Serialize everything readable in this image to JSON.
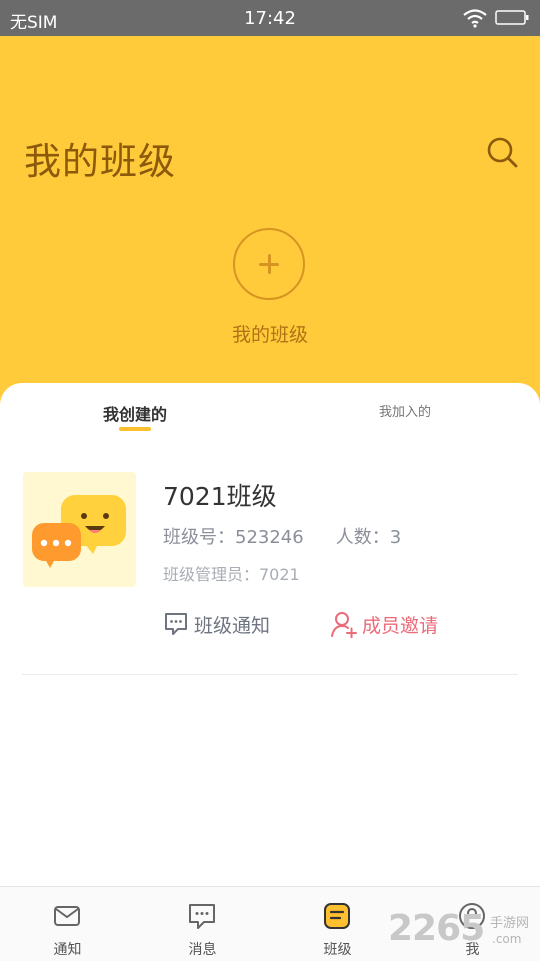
{
  "status_bar": {
    "carrier": "无SIM",
    "time": "17:42"
  },
  "header": {
    "title": "我的班级",
    "add_label": "我的班级"
  },
  "tabs": [
    {
      "label": "我创建的",
      "active": true
    },
    {
      "label": "我加入的",
      "active": false
    }
  ],
  "class_card": {
    "name": "7021班级",
    "number_text": "班级号：523246",
    "count_text": "人数：3",
    "admin_text": "班级管理员：7021",
    "notice_label": "班级通知",
    "invite_label": "成员邀请"
  },
  "nav": [
    {
      "label": "通知",
      "icon": "mail-icon",
      "active": false
    },
    {
      "label": "消息",
      "icon": "chat-icon",
      "active": false
    },
    {
      "label": "班级",
      "icon": "class-icon",
      "active": true
    },
    {
      "label": "我",
      "icon": "profile-icon",
      "active": false
    }
  ],
  "watermark": {
    "brand": "2265",
    "site": "手游网",
    "domain": ".com"
  },
  "colors": {
    "header_bg": "#ffcb3a",
    "accent": "#ffc02f",
    "title": "#8d5a0c",
    "invite": "#ec6b79"
  }
}
